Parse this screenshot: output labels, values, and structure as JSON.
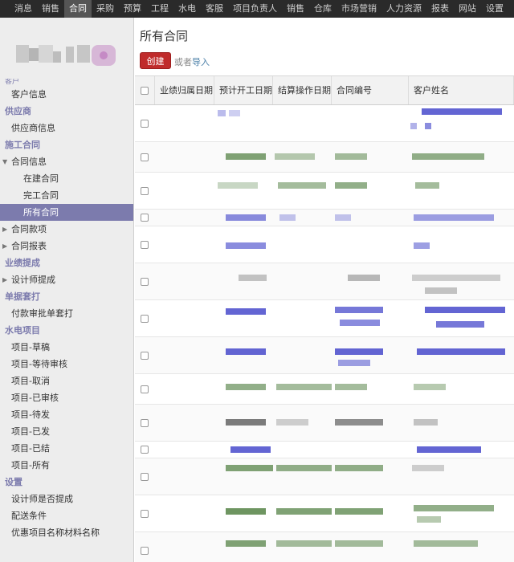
{
  "topnav": {
    "items": [
      "消息",
      "销售",
      "合同",
      "采购",
      "预算",
      "工程",
      "水电",
      "客服",
      "项目负责人",
      "销售",
      "仓库",
      "市场营销",
      "人力资源",
      "报表",
      "网站",
      "设置"
    ],
    "active_index": 2
  },
  "sidebar": {
    "groups": [
      {
        "items": [
          {
            "label": "客户信息",
            "level": 1
          }
        ]
      },
      {
        "title": "供应商",
        "items": [
          {
            "label": "供应商信息",
            "level": 1
          }
        ]
      },
      {
        "title": "施工合同",
        "items": [
          {
            "label": "合同信息",
            "level": 1,
            "arrow": "down"
          },
          {
            "label": "在建合同",
            "level": 2
          },
          {
            "label": "完工合同",
            "level": 2
          },
          {
            "label": "所有合同",
            "level": 2,
            "active": true
          },
          {
            "label": "合同款项",
            "level": 1,
            "arrow": "right"
          },
          {
            "label": "合同报表",
            "level": 1,
            "arrow": "right"
          }
        ]
      },
      {
        "title": "业绩提成",
        "items": [
          {
            "label": "设计师提成",
            "level": 1,
            "arrow": "right"
          }
        ]
      },
      {
        "title": "单据套打",
        "items": [
          {
            "label": "付款审批单套打",
            "level": 1
          }
        ]
      },
      {
        "title": "水电项目",
        "items": [
          {
            "label": "项目-草稿",
            "level": 1
          },
          {
            "label": "项目-等待审核",
            "level": 1
          },
          {
            "label": "项目-取消",
            "level": 1
          },
          {
            "label": "项目-已审核",
            "level": 1
          },
          {
            "label": "项目-待发",
            "level": 1
          },
          {
            "label": "项目-已发",
            "level": 1
          },
          {
            "label": "项目-已结",
            "level": 1
          },
          {
            "label": "项目-所有",
            "level": 1
          }
        ]
      },
      {
        "title": "设置",
        "items": [
          {
            "label": "设计师是否提成",
            "level": 1
          },
          {
            "label": "配送条件",
            "level": 1
          },
          {
            "label": "优惠项目名称材料名称",
            "level": 1
          }
        ]
      }
    ]
  },
  "main": {
    "title": "所有合同",
    "create_label": "创建",
    "or_text": "或者",
    "import_label": "导入",
    "columns": [
      "业绩归属日期",
      "预计开工日期",
      "结算操作日期",
      "合同编号",
      "客户姓名"
    ],
    "colors": {
      "blue": "#3c3fc8",
      "green": "#4a7a3a",
      "gray": "#8a8a8a",
      "dark": "#444444",
      "accent": "#7c7bad",
      "create": "#c02c2c"
    }
  }
}
